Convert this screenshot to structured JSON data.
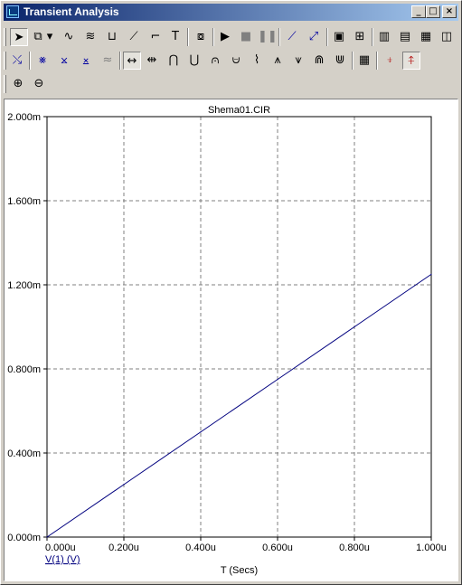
{
  "window": {
    "title": "Transient Analysis",
    "buttons": {
      "minimize": "_",
      "maximize": "□",
      "close": "×"
    }
  },
  "toolbar_row1": [
    {
      "icon": "select-arrow-icon",
      "glyph": "➤"
    },
    {
      "icon": "shape-select-icon",
      "glyph": "⧉"
    },
    {
      "icon": "dropdown-arrow-icon",
      "glyph": "▾"
    },
    {
      "icon": "waveform-icon",
      "glyph": "∿"
    },
    {
      "icon": "waveform-sum-icon",
      "glyph": "≋"
    },
    {
      "icon": "bracket-icon",
      "glyph": "⊔"
    },
    {
      "icon": "slope-icon",
      "glyph": "⟋"
    },
    {
      "icon": "step-icon",
      "glyph": "⌐"
    },
    {
      "icon": "text-tool-icon",
      "glyph": "T"
    },
    {
      "icon": "properties-icon",
      "glyph": "⧇"
    },
    {
      "icon": "run-icon",
      "glyph": "▶"
    },
    {
      "icon": "stop-icon",
      "glyph": "■"
    },
    {
      "icon": "pause-icon",
      "glyph": "❚❚"
    },
    {
      "icon": "line-tool-icon",
      "glyph": "⟋"
    },
    {
      "icon": "point-line-icon",
      "glyph": "⤢"
    },
    {
      "icon": "frame-icon",
      "glyph": "▣"
    },
    {
      "icon": "grid-icon",
      "glyph": "⊞"
    },
    {
      "icon": "vertical-grid-icon",
      "glyph": "▥"
    },
    {
      "icon": "horizontal-grid-icon",
      "glyph": "▤"
    },
    {
      "icon": "minor-grid-icon",
      "glyph": "▦"
    },
    {
      "icon": "split-grid-icon",
      "glyph": "◫"
    }
  ],
  "toolbar_row2": [
    {
      "icon": "cursor-data-points-icon",
      "glyph": "⤯"
    },
    {
      "icon": "next-simulation-icon",
      "glyph": "⨳"
    },
    {
      "icon": "peak-icon",
      "glyph": "⨲"
    },
    {
      "icon": "valley-icon",
      "glyph": "⨱"
    },
    {
      "icon": "branch-icon",
      "glyph": "≈"
    },
    {
      "icon": "cursor-left-right-icon",
      "glyph": "↔"
    },
    {
      "icon": "cursor-midpoint-icon",
      "glyph": "⇹"
    },
    {
      "icon": "peak-curve-icon",
      "glyph": "⋂"
    },
    {
      "icon": "valley-curve-icon",
      "glyph": "⋃"
    },
    {
      "icon": "high-icon",
      "glyph": "⩀"
    },
    {
      "icon": "low-icon",
      "glyph": "⩁"
    },
    {
      "icon": "inflection-icon",
      "glyph": "⌇"
    },
    {
      "icon": "global-high-icon",
      "glyph": "⩚"
    },
    {
      "icon": "global-low-icon",
      "glyph": "⩛"
    },
    {
      "icon": "top-icon",
      "glyph": "⋒"
    },
    {
      "icon": "bottom-icon",
      "glyph": "⋓"
    },
    {
      "icon": "table-icon",
      "glyph": "▦"
    },
    {
      "icon": "tag-vertical-icon",
      "glyph": "⍖"
    },
    {
      "icon": "tag-horizontal-icon",
      "glyph": "⍏"
    }
  ],
  "toolbar_row3": [
    {
      "icon": "zoom-in-icon",
      "glyph": "⊕"
    },
    {
      "icon": "zoom-out-icon",
      "glyph": "⊖"
    }
  ],
  "colors": {
    "trace": "#00007f",
    "grid": "#808080",
    "plot_bg": "#ffffff",
    "titlebar_start": "#0a246a",
    "titlebar_end": "#a6caf0"
  },
  "chart_data": {
    "type": "line",
    "title": "Shema01.CIR",
    "xlabel": "T (Secs)",
    "ylabel": "",
    "xlim": [
      0,
      1.0
    ],
    "ylim": [
      0,
      2.0
    ],
    "x_unit_note": "u",
    "y_unit_note": "m",
    "x_ticks": [
      "0.000u",
      "0.200u",
      "0.400u",
      "0.600u",
      "0.800u",
      "1.000u"
    ],
    "y_ticks": [
      "0.000m",
      "0.400m",
      "0.800m",
      "1.200m",
      "1.600m",
      "2.000m"
    ],
    "grid": true,
    "series": [
      {
        "name": "V(1) (V)",
        "x": [
          0,
          0.2,
          0.4,
          0.6,
          0.8,
          1.0
        ],
        "y": [
          0,
          0.25,
          0.5,
          0.75,
          1.0,
          1.25
        ]
      }
    ]
  }
}
